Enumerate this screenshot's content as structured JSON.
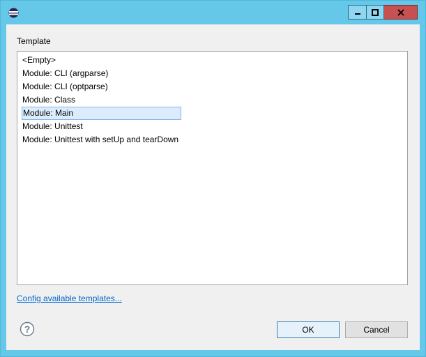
{
  "window": {
    "icon": "eclipse-icon",
    "controls": {
      "minimize": "minimize-icon",
      "maximize": "maximize-icon",
      "close": "close-icon"
    }
  },
  "dialog": {
    "section_label": "Template",
    "templates": [
      "<Empty>",
      "Module: CLI (argparse)",
      "Module: CLI (optparse)",
      "Module: Class",
      "Module: Main",
      "Module: Unittest",
      "Module: Unittest with setUp and tearDown"
    ],
    "selected_template": "Module: Main",
    "config_link": "Config available templates...",
    "help_icon": "help-icon",
    "ok_label": "OK",
    "cancel_label": "Cancel"
  },
  "colors": {
    "titlebar": "#65c8e9",
    "close_button": "#c75050",
    "selection_bg": "#dcecfc",
    "selection_border": "#7eb4ea",
    "link": "#0066cc"
  }
}
